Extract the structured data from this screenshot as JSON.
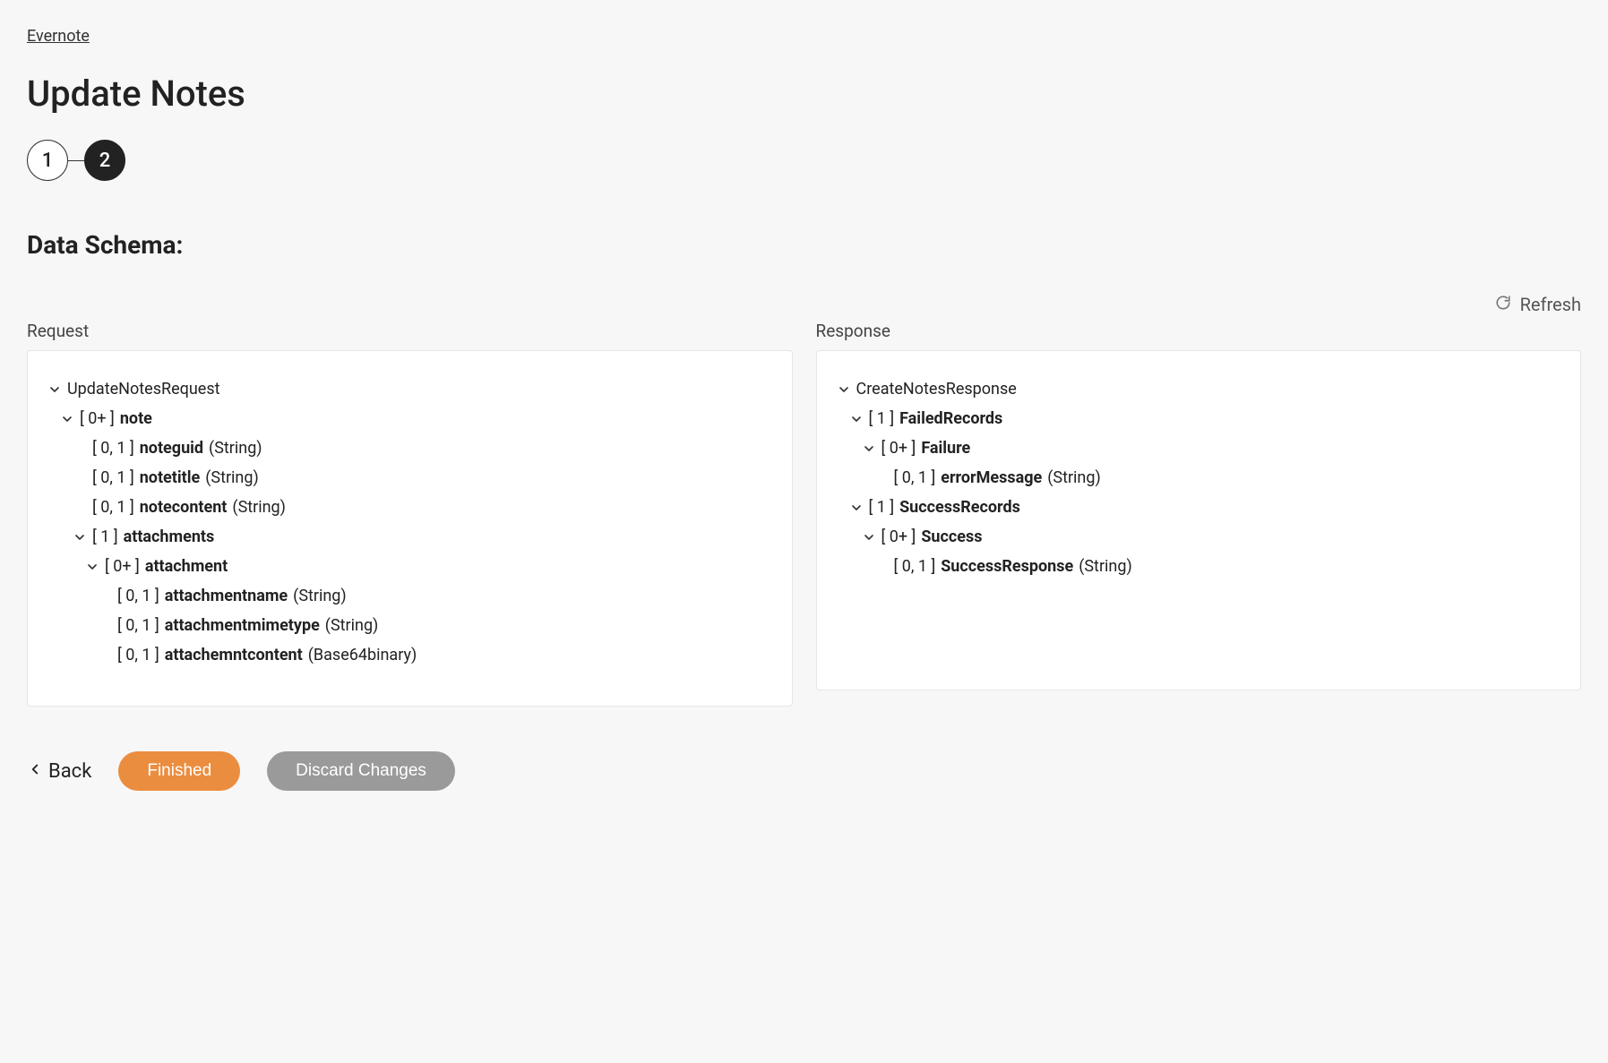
{
  "breadcrumb": "Evernote",
  "page_title": "Update Notes",
  "stepper": {
    "steps": [
      "1",
      "2"
    ],
    "active_index": 1
  },
  "section_header": "Data Schema:",
  "refresh_label": "Refresh",
  "request": {
    "label": "Request",
    "tree": [
      {
        "indent": 0,
        "chevron": true,
        "cardinality": "",
        "name": "UpdateNotesRequest",
        "type": "",
        "bold": false
      },
      {
        "indent": 1,
        "chevron": true,
        "cardinality": "[ 0+ ]",
        "name": "note",
        "type": "",
        "bold": true
      },
      {
        "indent": 2,
        "chevron": false,
        "cardinality": "[ 0, 1 ]",
        "name": "noteguid",
        "type": "(String)",
        "bold": true
      },
      {
        "indent": 2,
        "chevron": false,
        "cardinality": "[ 0, 1 ]",
        "name": "notetitle",
        "type": "(String)",
        "bold": true
      },
      {
        "indent": 2,
        "chevron": false,
        "cardinality": "[ 0, 1 ]",
        "name": "notecontent",
        "type": "(String)",
        "bold": true
      },
      {
        "indent": 2,
        "chevron": true,
        "cardinality": "[ 1 ]",
        "name": "attachments",
        "type": "",
        "bold": true
      },
      {
        "indent": 3,
        "chevron": true,
        "cardinality": "[ 0+ ]",
        "name": "attachment",
        "type": "",
        "bold": true
      },
      {
        "indent": 4,
        "chevron": false,
        "cardinality": "[ 0, 1 ]",
        "name": "attachmentname",
        "type": "(String)",
        "bold": true
      },
      {
        "indent": 4,
        "chevron": false,
        "cardinality": "[ 0, 1 ]",
        "name": "attachmentmimetype",
        "type": "(String)",
        "bold": true
      },
      {
        "indent": 4,
        "chevron": false,
        "cardinality": "[ 0, 1 ]",
        "name": "attachemntcontent",
        "type": "(Base64binary)",
        "bold": true
      }
    ]
  },
  "response": {
    "label": "Response",
    "tree": [
      {
        "indent": 0,
        "chevron": true,
        "cardinality": "",
        "name": "CreateNotesResponse",
        "type": "",
        "bold": false
      },
      {
        "indent": 1,
        "chevron": true,
        "cardinality": "[ 1 ]",
        "name": "FailedRecords",
        "type": "",
        "bold": true
      },
      {
        "indent": 2,
        "chevron": true,
        "cardinality": "[ 0+ ]",
        "name": "Failure",
        "type": "",
        "bold": true
      },
      {
        "indent": 3,
        "chevron": false,
        "cardinality": "[ 0, 1 ]",
        "name": "errorMessage",
        "type": "(String)",
        "bold": true
      },
      {
        "indent": 1,
        "chevron": true,
        "cardinality": "[ 1 ]",
        "name": "SuccessRecords",
        "type": "",
        "bold": true
      },
      {
        "indent": 2,
        "chevron": true,
        "cardinality": "[ 0+ ]",
        "name": "Success",
        "type": "",
        "bold": true
      },
      {
        "indent": 3,
        "chevron": false,
        "cardinality": "[ 0, 1 ]",
        "name": "SuccessResponse",
        "type": "(String)",
        "bold": true
      }
    ]
  },
  "actions": {
    "back": "Back",
    "finished": "Finished",
    "discard": "Discard Changes"
  }
}
